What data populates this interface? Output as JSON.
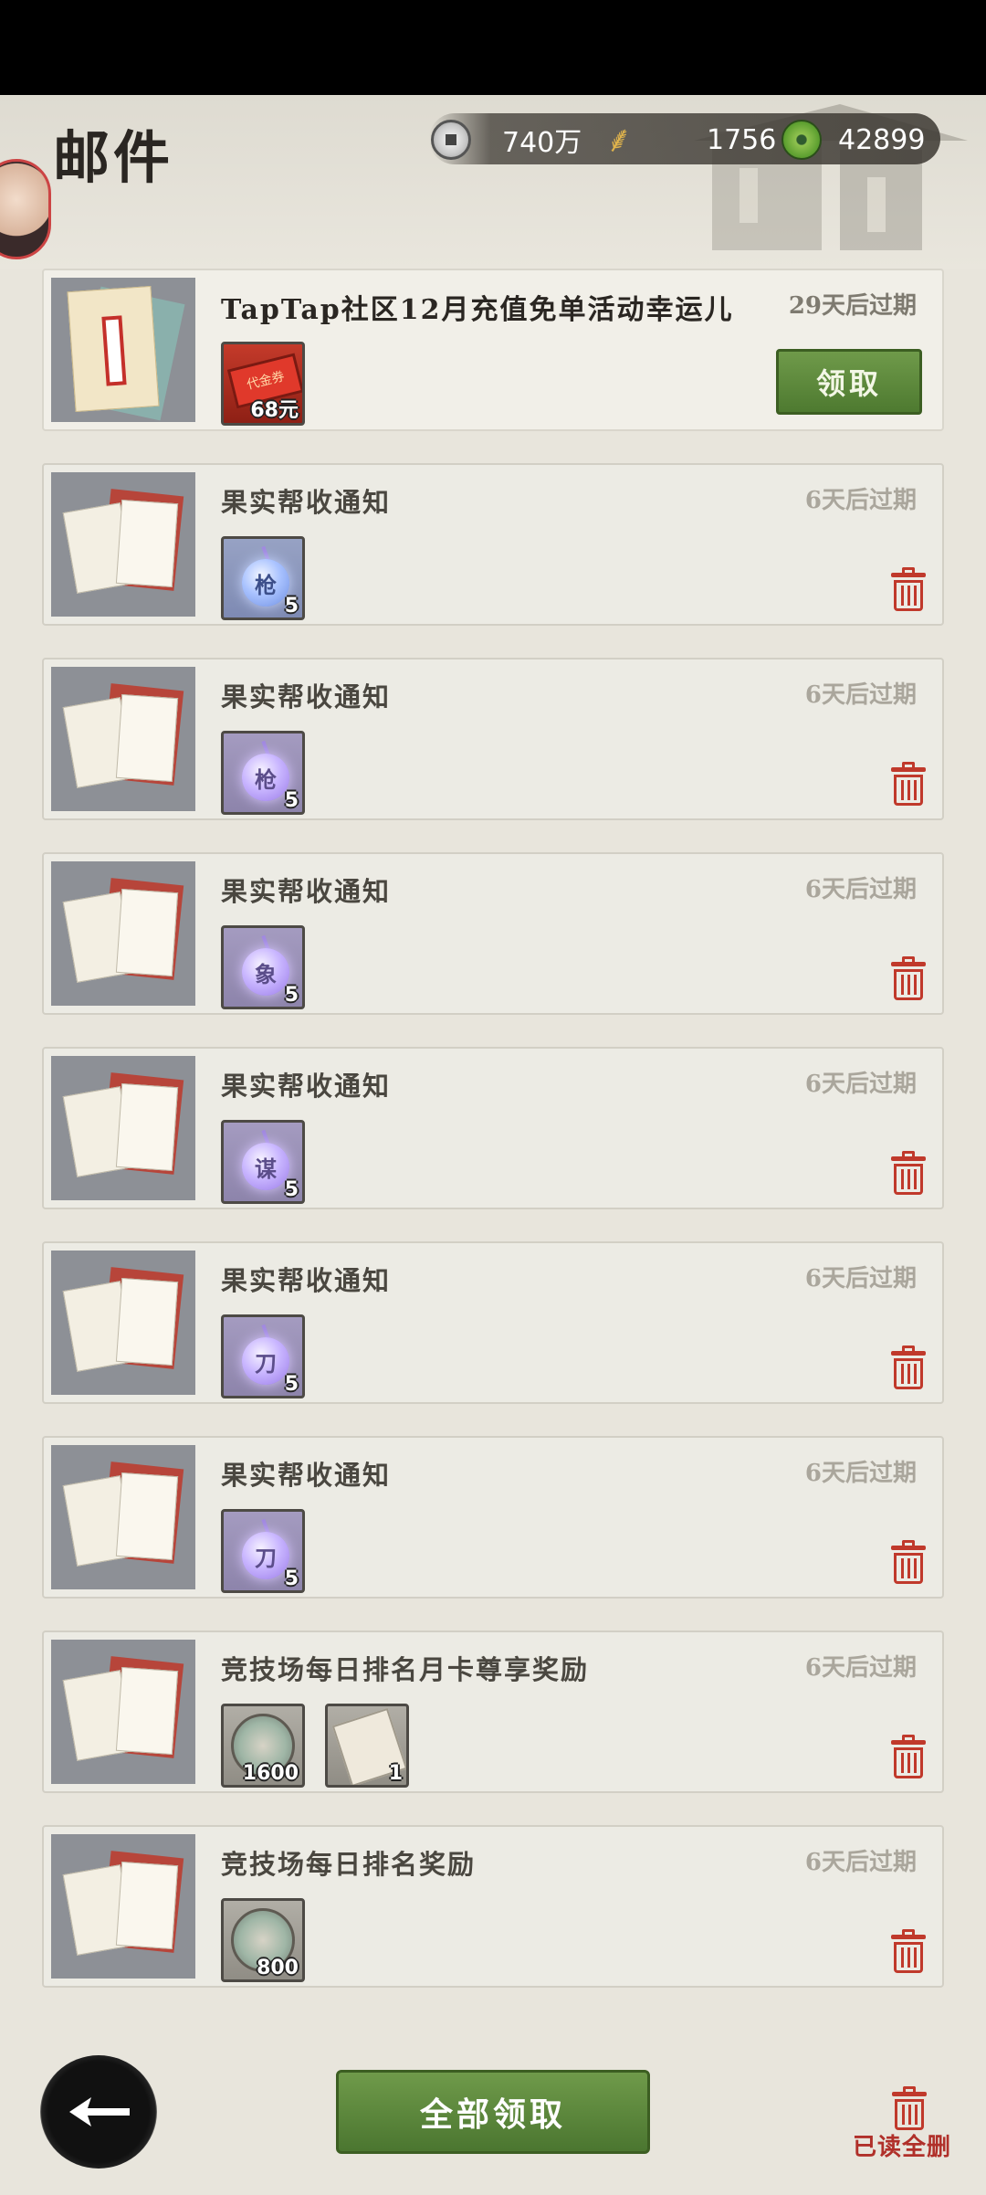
{
  "header": {
    "title": "邮件",
    "resources": {
      "coins": "740万",
      "grain": "1756",
      "jade": "42899"
    }
  },
  "mails": [
    {
      "subject": "TapTap社区12月充值免单活动幸运儿",
      "expiry": "29天后过期",
      "items": [
        {
          "icon": "voucher-icon",
          "qty": "68元"
        }
      ],
      "action": "领取"
    },
    {
      "subject": "果实帮收通知",
      "expiry": "6天后过期",
      "items": [
        {
          "icon": "orb-blue",
          "char": "枪",
          "qty": "5"
        }
      ]
    },
    {
      "subject": "果实帮收通知",
      "expiry": "6天后过期",
      "items": [
        {
          "icon": "orb-purple",
          "char": "枪",
          "qty": "5"
        }
      ]
    },
    {
      "subject": "果实帮收通知",
      "expiry": "6天后过期",
      "items": [
        {
          "icon": "orb-purple",
          "char": "象",
          "qty": "5"
        }
      ]
    },
    {
      "subject": "果实帮收通知",
      "expiry": "6天后过期",
      "items": [
        {
          "icon": "orb-purple",
          "char": "谋",
          "qty": "5"
        }
      ]
    },
    {
      "subject": "果实帮收通知",
      "expiry": "6天后过期",
      "items": [
        {
          "icon": "orb-purple",
          "char": "刀",
          "qty": "5"
        }
      ]
    },
    {
      "subject": "果实帮收通知",
      "expiry": "6天后过期",
      "items": [
        {
          "icon": "orb-purple",
          "char": "刀",
          "qty": "5"
        }
      ]
    },
    {
      "subject": "竞技场每日排名月卡尊享奖励",
      "expiry": "6天后过期",
      "items": [
        {
          "icon": "dragon-medal-icon",
          "qty": "1600"
        },
        {
          "icon": "ticket-icon",
          "qty": "1"
        }
      ]
    },
    {
      "subject": "竞技场每日排名奖励",
      "expiry": "6天后过期",
      "items": [
        {
          "icon": "dragon-medal-icon",
          "qty": "800"
        }
      ]
    }
  ],
  "footer": {
    "claim_all": "全部领取",
    "delete_read": "已读全删"
  },
  "colors": {
    "accent_green": "#5b8a3a",
    "delete_red": "#c0392b"
  }
}
